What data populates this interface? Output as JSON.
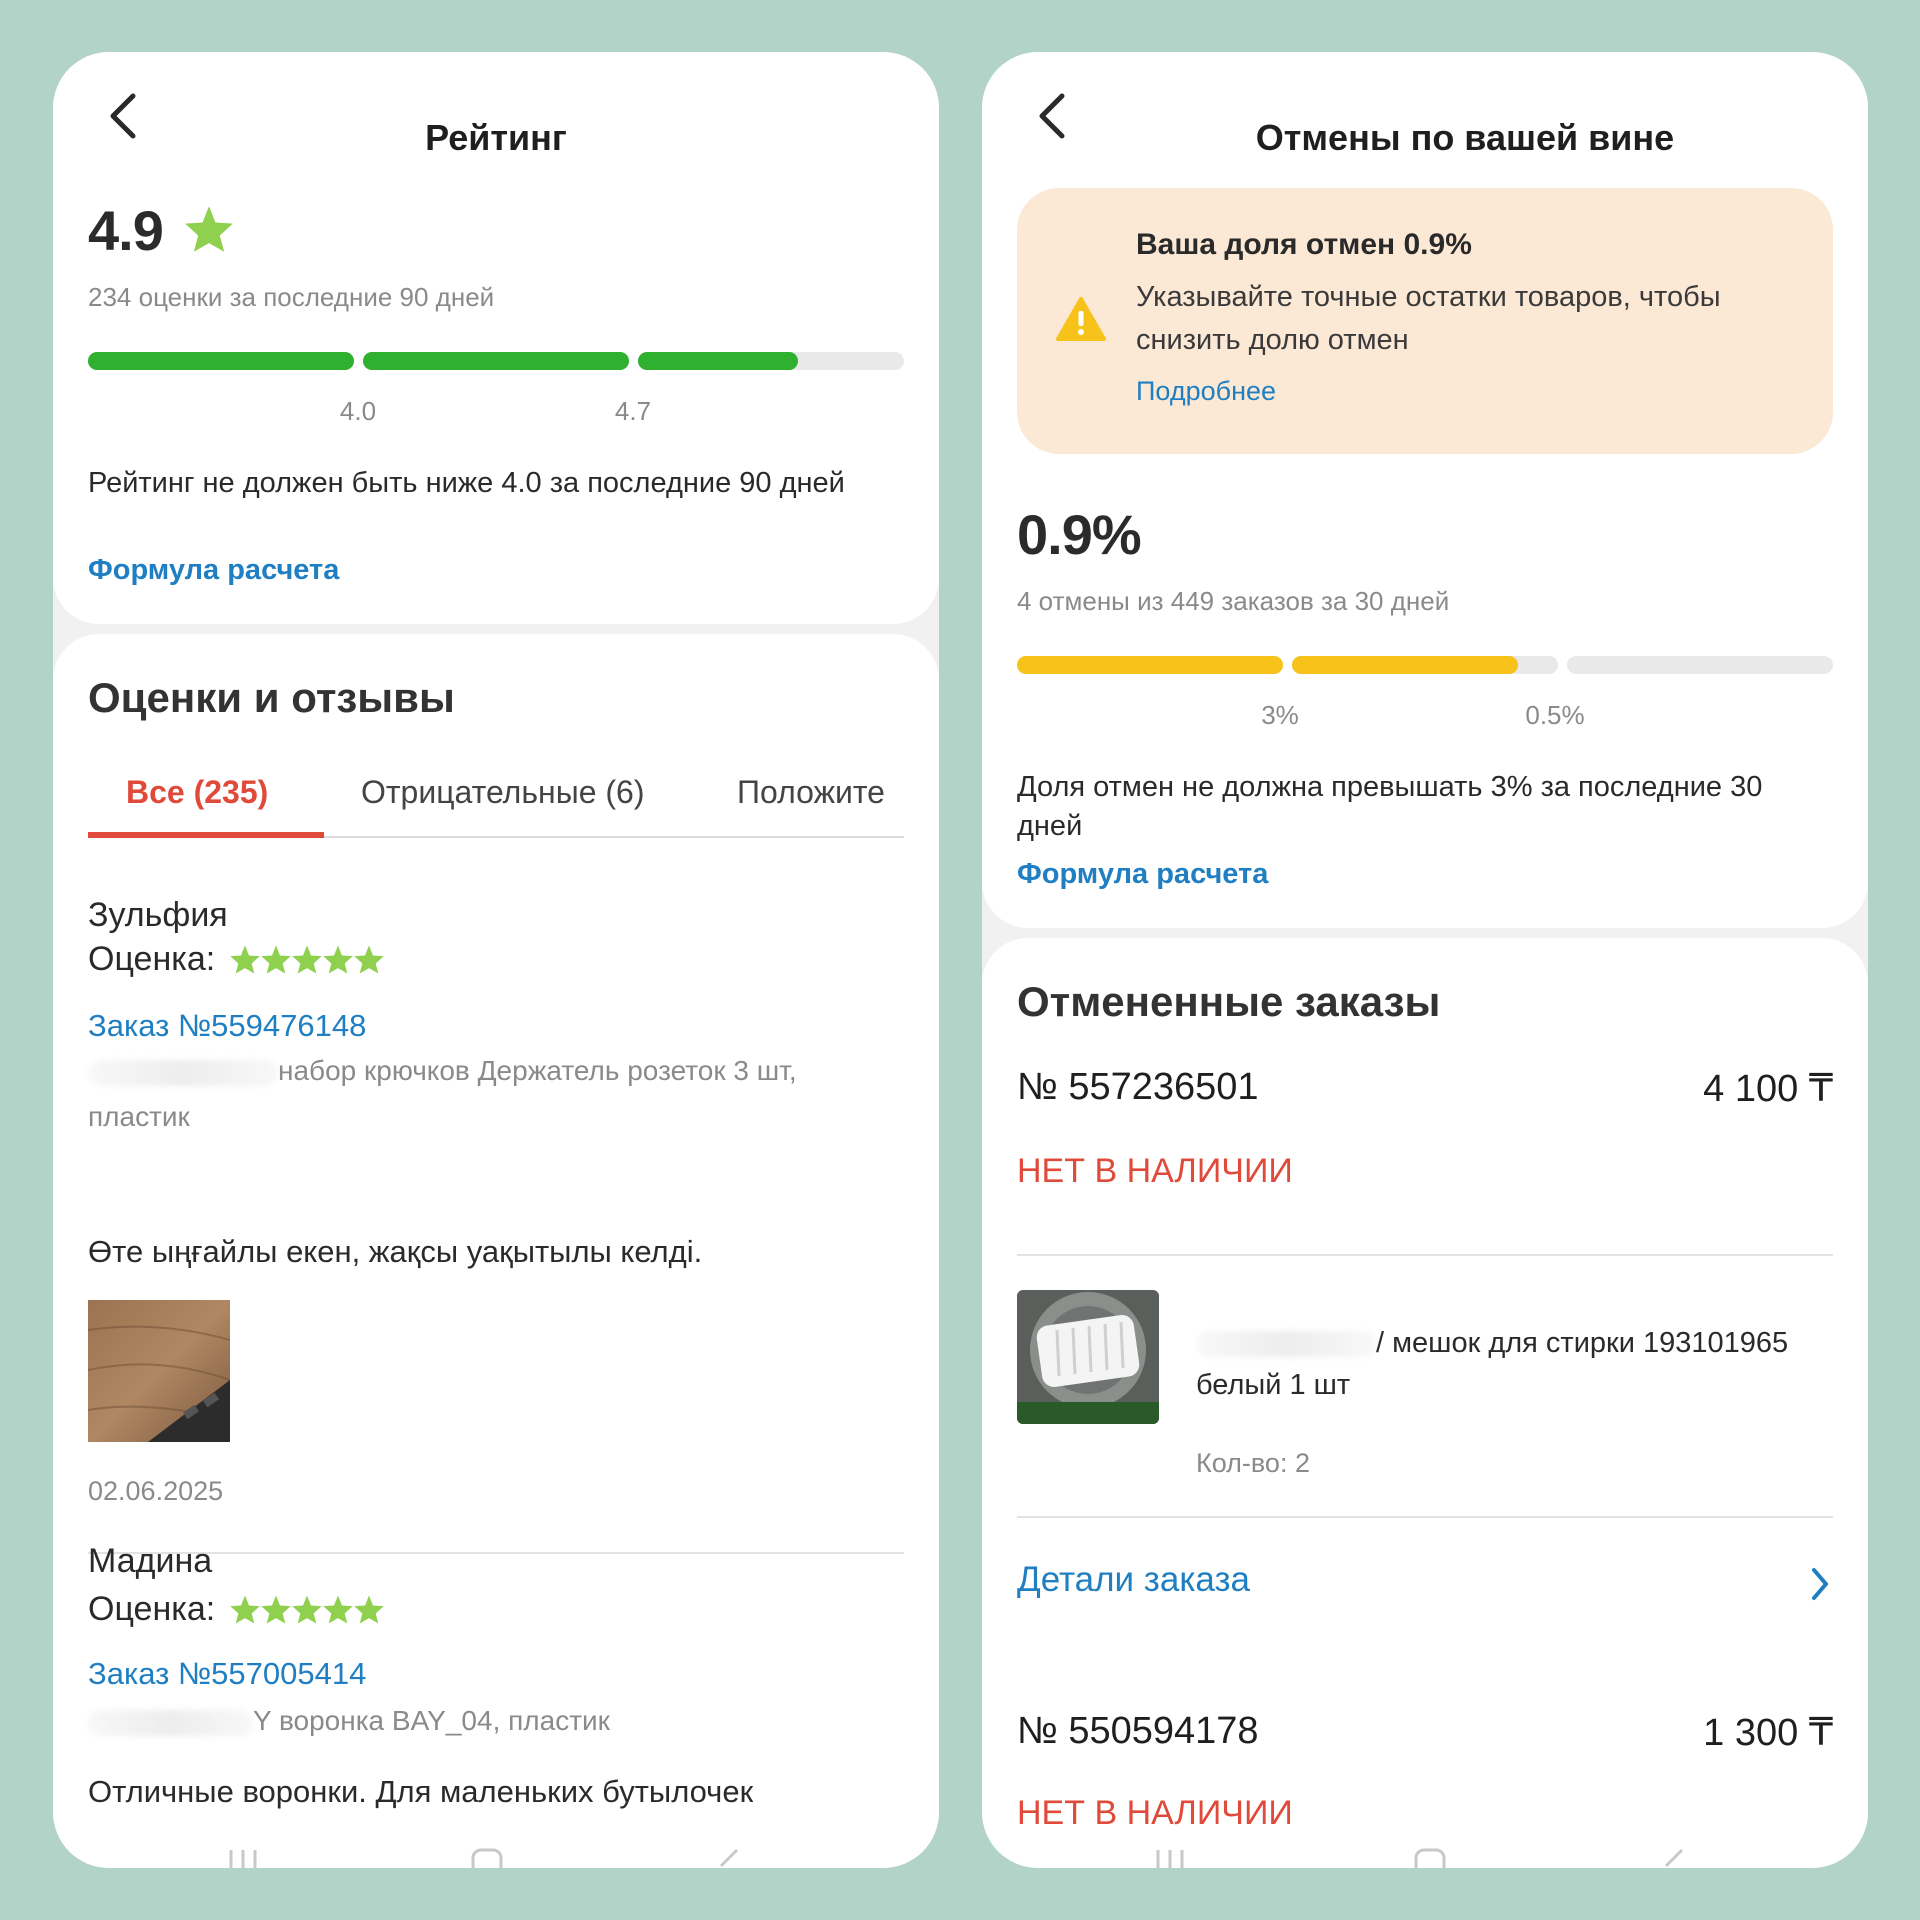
{
  "rating_screen": {
    "header_title": "Рейтинг",
    "value": "4.9",
    "sub": "234 оценки за последние 90 дней",
    "progress": {
      "segments": [
        1.0,
        1.0,
        0.6
      ],
      "tick_labels": [
        "4.0",
        "4.7"
      ]
    },
    "description": "Рейтинг не должен быть ниже 4.0 за последние 90 дней",
    "formula_link": "Формула расчета",
    "reviews": {
      "title": "Оценки и отзывы",
      "tabs": [
        {
          "label": "Все (235)",
          "active": true
        },
        {
          "label": "Отрицательные (6)",
          "active": false
        },
        {
          "label": "Положите",
          "active": false
        }
      ],
      "items": [
        {
          "name": "Зульфия",
          "rating_label": "Оценка:",
          "stars": 5,
          "order": "Заказ №559476148",
          "product_line1": "набор крючков Держатель розеток 3 шт,",
          "product_line2": "пластик",
          "comment": "Өте ыңғайлы екен, жақсы уақытылы келді.",
          "date": "02.06.2025"
        },
        {
          "name": "Мадина",
          "rating_label": "Оценка:",
          "stars": 5,
          "order": "Заказ №557005414",
          "product_line1": "Y воронка BAY_04, пластик",
          "comment": "Отличные воронки. Для маленьких бутылочек"
        }
      ]
    }
  },
  "cancel_screen": {
    "header_title": "Отмены по вашей вине",
    "warning": {
      "title": "Ваша доля отмен 0.9%",
      "text": "Указывайте точные остатки товаров, чтобы снизить долю отмен",
      "link": "Подробнее"
    },
    "value": "0.9%",
    "sub": "4 отмены из 449 заказов за 30 дней",
    "progress": {
      "segments": [
        1.0,
        0.85,
        0.0
      ],
      "tick_labels": [
        "3%",
        "0.5%"
      ]
    },
    "description": "Доля отмен не должна превышать 3% за последние 30 дней",
    "formula_link": "Формула расчета",
    "cancelled": {
      "title": "Отмененные заказы",
      "orders": [
        {
          "number": "№ 557236501",
          "price": "4 100 ₸",
          "status": "НЕТ В НАЛИЧИИ",
          "item_name_line1": "/ мешок для стирки 193101965",
          "item_name_line2": "белый 1 шт",
          "qty": "Кол-во: 2",
          "details_link": "Детали заказа"
        },
        {
          "number": "№ 550594178",
          "price": "1 300 ₸",
          "status": "НЕТ В НАЛИЧИИ"
        }
      ]
    }
  },
  "colors": {
    "green": "#2fb02e",
    "yellow": "#f7c21a",
    "link": "#1f7fc2",
    "red": "#e04a3a",
    "star": "#8fd14f"
  }
}
